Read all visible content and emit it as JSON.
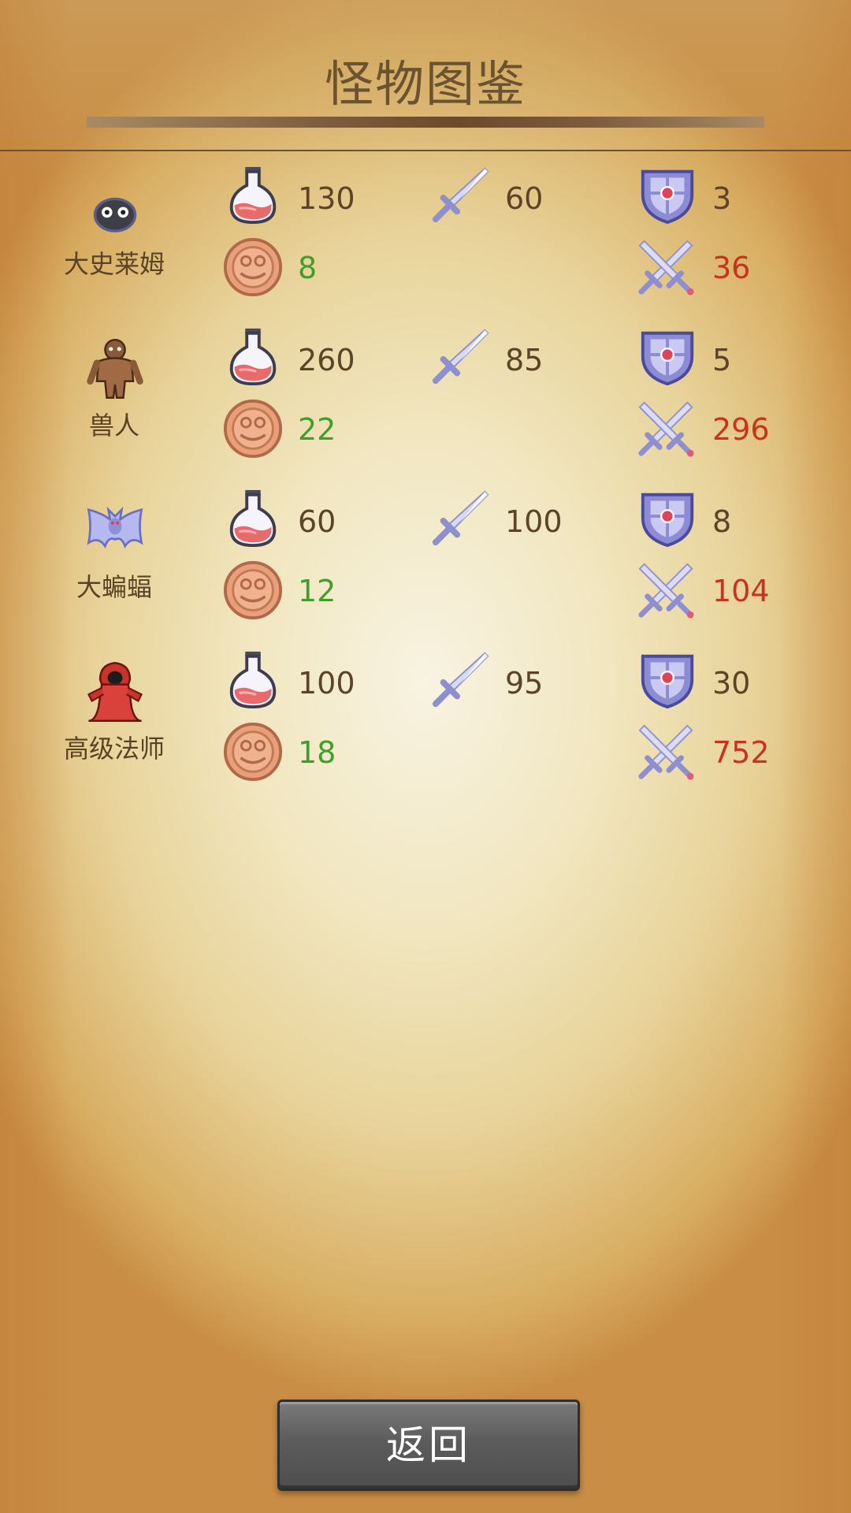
{
  "header": {
    "title": "怪物图鉴"
  },
  "monsters": [
    {
      "name": "大史莱姆",
      "sprite": "slime-icon",
      "hp": "130",
      "attack": "60",
      "defense": "3",
      "gold": "8",
      "damage": "36"
    },
    {
      "name": "兽人",
      "sprite": "orc-icon",
      "hp": "260",
      "attack": "85",
      "defense": "5",
      "gold": "22",
      "damage": "296"
    },
    {
      "name": "大蝙蝠",
      "sprite": "bat-icon",
      "hp": "60",
      "attack": "100",
      "defense": "8",
      "gold": "12",
      "damage": "104"
    },
    {
      "name": "高级法师",
      "sprite": "mage-icon",
      "hp": "100",
      "attack": "95",
      "defense": "30",
      "gold": "18",
      "damage": "752"
    }
  ],
  "stat_icons": {
    "hp": "potion-icon",
    "attack": "sword-icon",
    "defense": "shield-icon",
    "gold": "coin-icon",
    "damage": "crossed-swords-icon"
  },
  "colors": {
    "text": "#5b4428",
    "gold_value": "#3f9f2a",
    "damage_value": "#c8321e"
  },
  "footer": {
    "back_label": "返回"
  }
}
